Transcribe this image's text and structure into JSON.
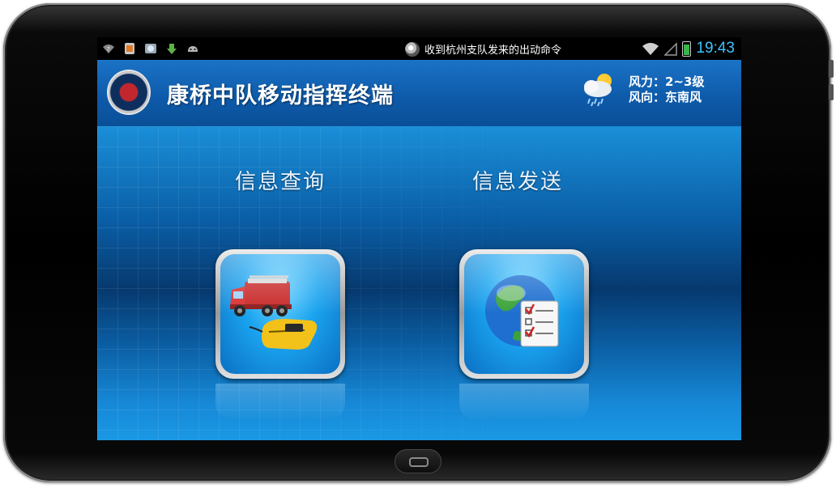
{
  "statusbar": {
    "notification_text": "收到杭州支队发来的出动命令",
    "time": "19:43"
  },
  "header": {
    "title": "康桥中队移动指挥终端",
    "wind_force": "风力：2~3级",
    "wind_direction": "风向：东南风"
  },
  "menu": {
    "items": [
      {
        "label": "信息查询",
        "icon": "fire-truck-icon"
      },
      {
        "label": "信息发送",
        "icon": "globe-checklist-icon"
      }
    ]
  },
  "colors": {
    "header_blue": "#1b73c6",
    "clock_cyan": "#3ec3ff"
  }
}
